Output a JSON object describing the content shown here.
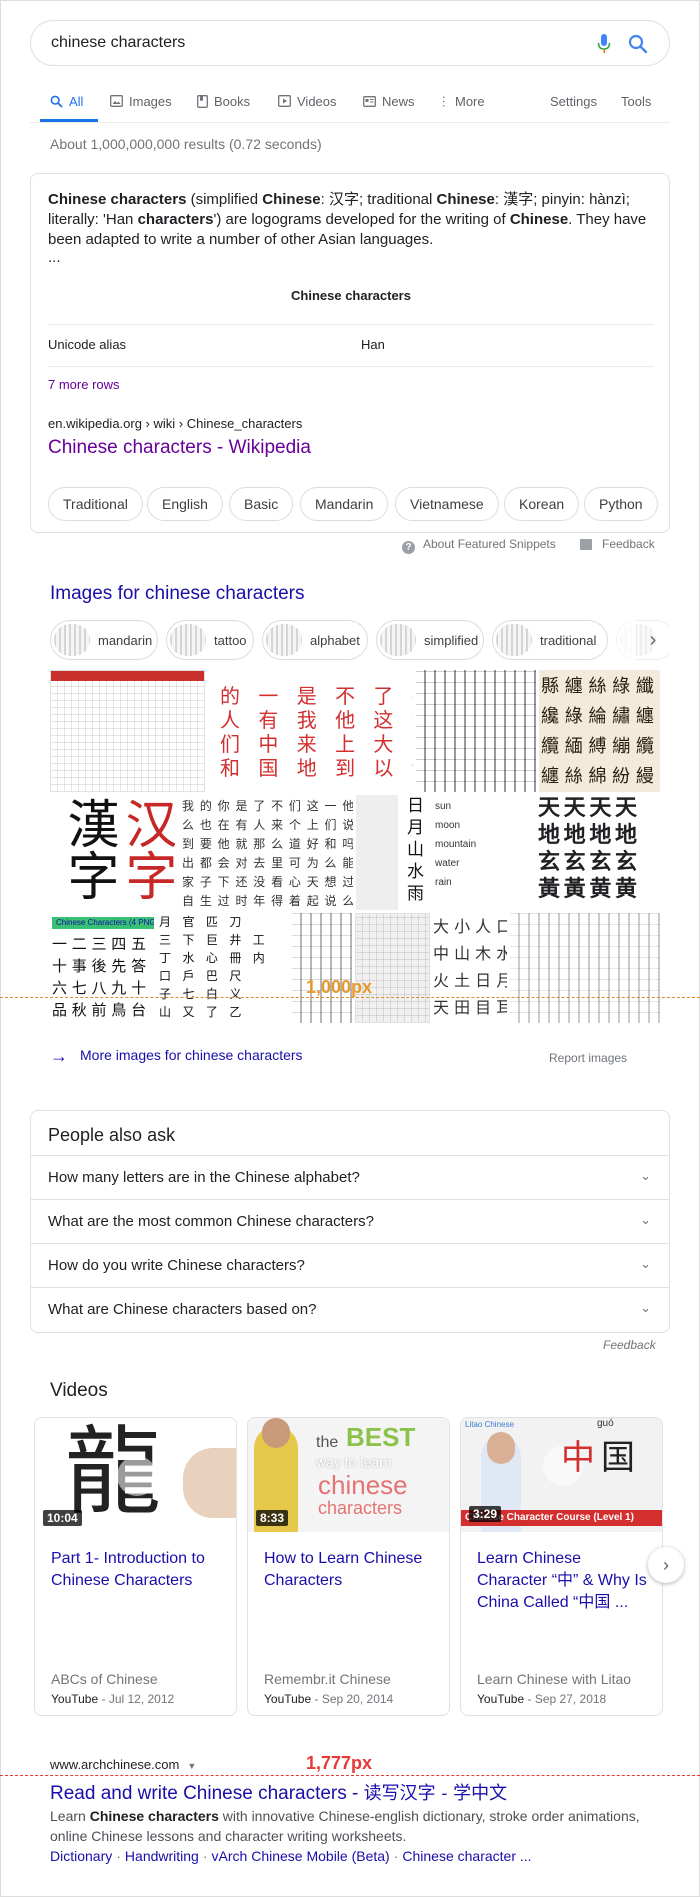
{
  "search": {
    "query": "chinese characters"
  },
  "tabs": {
    "all": "All",
    "images": "Images",
    "books": "Books",
    "videos": "Videos",
    "news": "News",
    "more": "More",
    "settings": "Settings",
    "tools": "Tools"
  },
  "stats": "About 1,000,000,000 results (0.72 seconds)",
  "snippet": {
    "p1_b1": "Chinese characters",
    "p1_t1": " (simplified ",
    "p1_b2": "Chinese",
    "p1_t2": ": 汉字; traditional ",
    "p1_b3": "Chinese",
    "p1_t3": ": 漢字; pinyin: hànzì; literally: 'Han ",
    "p1_b4": "characters",
    "p1_t4": "') are logograms developed for the writing of ",
    "p1_b5": "Chinese",
    "p1_t5": ". They have been adapted to write a number of other Asian languages.",
    "ellipsis": "...",
    "table_title": "Chinese characters",
    "table_key": "Unicode alias",
    "table_value": "Han",
    "more_rows": "7 more rows",
    "cite": "en.wikipedia.org › wiki › Chinese_characters",
    "title": "Chinese characters - Wikipedia",
    "chips": [
      "Traditional",
      "English",
      "Basic",
      "Mandarin",
      "Vietnamese",
      "Korean",
      "Python"
    ],
    "about": "About Featured Snippets",
    "feedback": "Feedback"
  },
  "images": {
    "heading": "Images for chinese characters",
    "chips": [
      "mandarin",
      "tattoo",
      "alphabet",
      "simplified",
      "traditional"
    ],
    "more": "More images for chinese characters",
    "report": "Report images",
    "marker": "1,000px",
    "tile_big1": "漢字",
    "tile_big2": "汉字",
    "tile_red": "的 一 是 不 了 在\n人 有 我 他 这 个\n们 中 来 上 大 为\n和 国 地 到 以 说",
    "tile_words": [
      "sun",
      "moon",
      "mountain",
      "water",
      "rain"
    ],
    "tile_nature": "日\n月\n山\n水\n雨",
    "tile_thick": "天 天 天 天\n地 地 地 地\n玄 玄 玄 玄\n黃 黃 黄 黄",
    "tile_seal": "縣 纏 絲 綠 纖 絓\n纔 綠 綸 繡 纏 綰\n纜 緬 縛 繃 纜 緜\n纏 絲 綿 紛 縵 緝",
    "tile_fluency": "一 二 三 四 五\n十 事 後 先 答\n六 七 八 九 十\n品 秋 前 鳥 台",
    "tile_fluency_tag": "Chinese Characters (4 PNG · SPS · TFS",
    "tile_hand": "月   官   匹   刀\n三   下   巨   井   工\n丁   水   心   冊   内\n口   戶   巴   尺\n子   七   白   义\n山   又   了   乙",
    "tile_dense": "我 的 你 是 了 不 们 这 一 他\n么 也 在 有 人 来 个 上 们 说\n到 要 他 就 那 么 道 好 和 吗\n出 都 会 对 去 里 可 为 么 能\n家 子 下 还 没 看 心 天 想 过\n自 生 过 时 年 得 着 起 说 么",
    "tile_misc": "大 小 人 口\n中 山 木 水\n火 土 日 月\n天 田 目 耳"
  },
  "paa": {
    "title": "People also ask",
    "questions": [
      "How many letters are in the Chinese alphabet?",
      "What are the most common Chinese characters?",
      "How do you write Chinese characters?",
      "What are Chinese characters based on?"
    ],
    "feedback": "Feedback"
  },
  "videos": {
    "heading": "Videos",
    "items": [
      {
        "duration": "10:04",
        "title": "Part 1- Introduction to Chinese Characters",
        "channel": "ABCs of Chinese",
        "source": "YouTube",
        "date": " - Jul 12, 2012"
      },
      {
        "duration": "8:33",
        "title": "How to Learn Chinese Characters",
        "channel": "Remembr.it Chinese",
        "source": "YouTube",
        "date": " - Sep 20, 2014"
      },
      {
        "duration": "3:29",
        "title": "Learn Chinese Character “中” & Why Is China Called “中国 ...",
        "channel": "Learn Chinese with Litao",
        "source": "YouTube",
        "date": " - Sep 27, 2018"
      }
    ],
    "thumb1_glyph": "龍",
    "thumb2_the": "the",
    "thumb2_best": "BEST",
    "thumb2_way": "way to learn",
    "thumb2_chinese": "chinese",
    "thumb2_chars": "characters",
    "thumb3_glyph_red": "中",
    "thumb3_glyph": "国",
    "thumb3_pinyin": "guó",
    "thumb3_banner": "Chinese Character Course (Level 1)",
    "thumb3_logo": "Litao Chinese"
  },
  "result": {
    "cite": "www.archchinese.com",
    "marker": "1,777px",
    "title": "Read and write Chinese characters - ",
    "title_cjk": "读写汉字 - 学中文",
    "snip_t1": "Learn ",
    "snip_b1": "Chinese characters",
    "snip_t2": " with innovative Chinese-english dictionary, stroke order animations, online Chinese lessons and character writing worksheets.",
    "links": [
      "Dictionary",
      "Handwriting",
      "vArch Chinese Mobile (Beta)",
      "Chinese character ..."
    ]
  },
  "colors": {
    "link": "#1a0dab",
    "visited": "#660099",
    "accent": "#1a73e8"
  }
}
